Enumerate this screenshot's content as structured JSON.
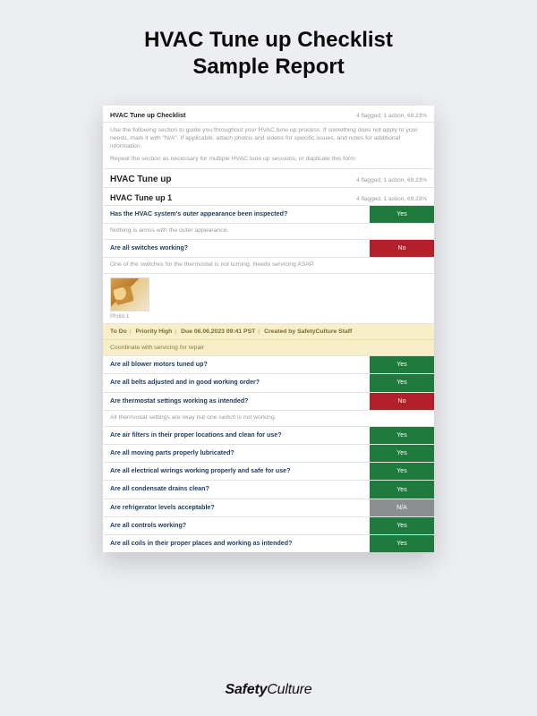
{
  "page": {
    "title_line1": "HVAC Tune up Checklist",
    "title_line2": "Sample Report"
  },
  "header": {
    "title": "HVAC Tune up Checklist",
    "meta": "4 flagged, 1 action, 69.23%"
  },
  "guide": {
    "p1": "Use the following section to guide you throughout your HVAC tune up process. If something does not apply to your needs, mark it with \"N/A\". If applicable, attach photos and videos for specific issues, and notes for additional information.",
    "p2": "Repeat the section as necessary for multiple HVAC tune up sessions, or duplicate this form."
  },
  "section": {
    "title": "HVAC Tune up",
    "meta": "4 flagged, 1 action, 69.23%"
  },
  "subsection": {
    "title": "HVAC Tune up 1",
    "meta": "4 flagged, 1 action, 69.23%"
  },
  "answers": {
    "yes": "Yes",
    "no": "No",
    "na": "N/A"
  },
  "q1": {
    "text": "Has the HVAC system's outer appearance been inspected?",
    "note": "Nothing is amiss with the outer appearance."
  },
  "q2": {
    "text": "Are all switches working?",
    "note": "One of the switches for the thermostat is not turning. Needs servicing ASAP."
  },
  "photo": {
    "caption": "Photo 1"
  },
  "todo": {
    "status": "To Do",
    "priority": "Priority High",
    "due": "Due 06.06.2023 09:41 PST",
    "creator": "Created by SafetyCulture Staff",
    "note": "Coordinate with servicing for repair"
  },
  "q3": {
    "text": "Are all blower motors tuned up?"
  },
  "q4": {
    "text": "Are all belts adjusted and in good working order?"
  },
  "q5": {
    "text": "Are thermostat settings working as intended?",
    "note": "All thermostat settings are okay but one switch is not working."
  },
  "q6": {
    "text": "Are air filters in their proper locations and clean for use?"
  },
  "q7": {
    "text": "Are all moving parts properly lubricated?"
  },
  "q8": {
    "text": "Are all electrical wirings working properly and safe for use?"
  },
  "q9": {
    "text": "Are all condensate drains clean?"
  },
  "q10": {
    "text": "Are refrigerator levels acceptable?"
  },
  "q11": {
    "text": "Are all controls working?"
  },
  "q12": {
    "text": "Are all coils in their proper places and working as intended?"
  },
  "brand": {
    "part1": "Safety",
    "part2": "Culture"
  }
}
